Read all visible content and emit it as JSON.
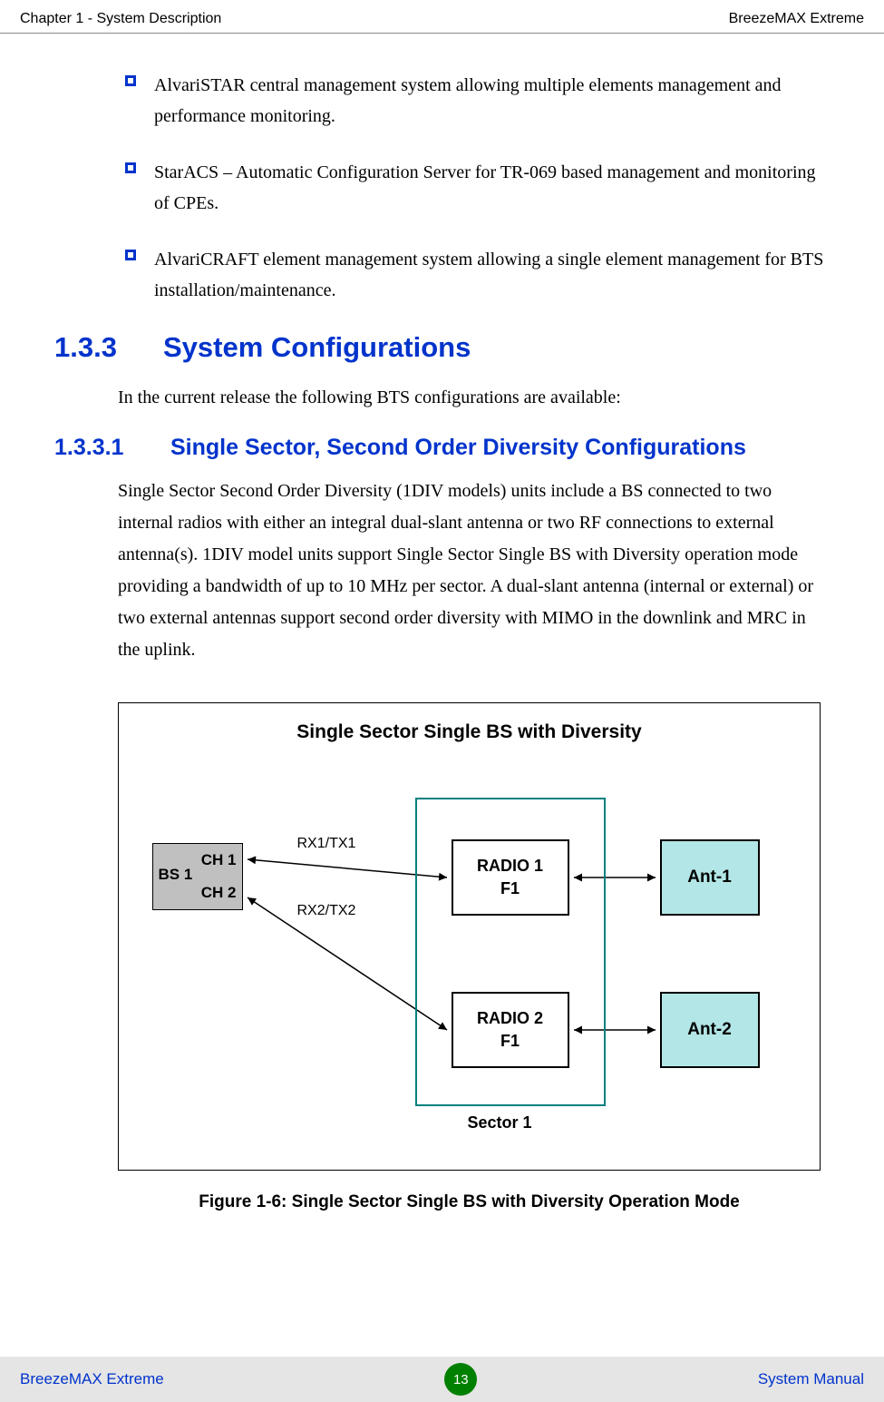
{
  "header": {
    "left": "Chapter 1 - System Description",
    "right": "BreezeMAX Extreme"
  },
  "bullets": [
    "AlvariSTAR central management system allowing multiple elements management and performance monitoring.",
    "StarACS – Automatic Configuration Server for TR-069 based management and monitoring of CPEs.",
    "AlvariCRAFT element management system allowing a single element management for BTS installation/maintenance."
  ],
  "section": {
    "number": "1.3.3",
    "title": "System Configurations",
    "intro": "In the current release the following BTS configurations are available:"
  },
  "subsection": {
    "number": "1.3.3.1",
    "title": "Single Sector, Second Order Diversity Configurations",
    "body": "Single Sector Second Order Diversity (1DIV models) units include a BS connected to two internal radios with either an integral dual-slant antenna or two RF connections to external antenna(s).  1DIV model units support Single Sector Single BS with Diversity operation mode providing a bandwidth of up to 10 MHz per sector. A dual-slant antenna (internal or external) or two external antennas support second order diversity with MIMO in the downlink and MRC in the uplink."
  },
  "figure": {
    "title": "Single Sector Single BS with Diversity",
    "bs": "BS 1",
    "ch1": "CH 1",
    "ch2": "CH 2",
    "rx1": "RX1/TX1",
    "rx2": "RX2/TX2",
    "radio1_l1": "RADIO 1",
    "radio1_l2": "F1",
    "radio2_l1": "RADIO 2",
    "radio2_l2": "F1",
    "ant1": "Ant-1",
    "ant2": "Ant-2",
    "sector": "Sector 1",
    "caption": "Figure 1-6: Single Sector Single BS with Diversity Operation Mode"
  },
  "footer": {
    "left": "BreezeMAX Extreme",
    "page": "13",
    "right": "System Manual"
  }
}
